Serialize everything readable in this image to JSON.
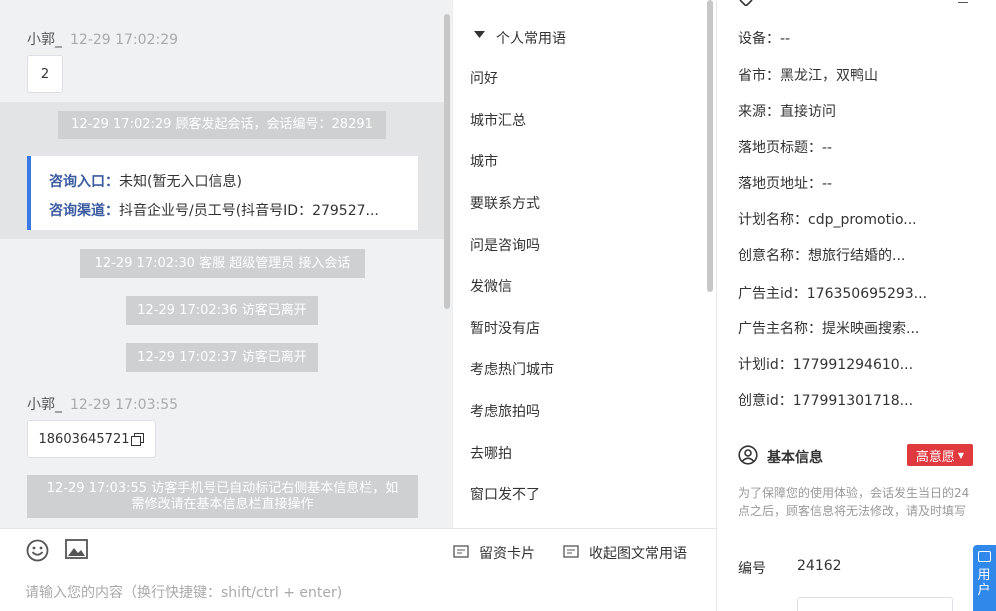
{
  "chat": {
    "msg1": {
      "sender": "小郭_",
      "time": "12-29 17:02:29",
      "text": "2"
    },
    "sys_start": "12-29 17:02:29 顾客发起会话，会话编号：28291",
    "info_card": {
      "entry_label": "咨询入口：",
      "entry_value": "未知(暂无入口信息)",
      "channel_label": "咨询渠道：",
      "channel_value": "抖音企业号/员工号(抖音号ID：279527..."
    },
    "sys_accept": "12-29 17:02:30 客服 超级管理员 接入会话",
    "sys_leave1": "12-29 17:02:36 访客已离开",
    "sys_leave2": "12-29 17:02:37 访客已离开",
    "msg2": {
      "sender": "小郭_",
      "time": "12-29 17:03:55",
      "text": "18603645721"
    },
    "sys_phone": "12-29 17:03:55 访客手机号已自动标记右侧基本信息栏，如需修改请在基本信息栏直接操作"
  },
  "composer": {
    "placeholder": "请输入您的内容（换行快捷键：shift/ctrl + enter)",
    "lead_card_label": "留资卡片",
    "collapse_label": "收起图文常用语"
  },
  "phrases": {
    "group_label": "个人常用语",
    "items": [
      "问好",
      "城市汇总",
      "城市",
      "要联系方式",
      "问是咨询吗",
      "发微信",
      "暂时没有店",
      "考虑热门城市",
      "考虑旅拍吗",
      "去哪拍",
      "窗口发不了"
    ]
  },
  "visitor_info": {
    "device": "设备：--",
    "province": "省市：黑龙江，双鸭山",
    "source": "来源：直接访问",
    "landing_title": "落地页标题：--",
    "landing_url": "落地页地址：--",
    "plan_name": "计划名称：cdp_promotio...",
    "creative_name": "创意名称：想旅行结婚的...",
    "advertiser_id": "广告主id：176350695293...",
    "advertiser_name": "广告主名称：提米映画搜索...",
    "plan_id": "计划id：177991294610...",
    "creative_id": "创意id：177991301718..."
  },
  "basic_info": {
    "title": "基本信息",
    "intent_tag": "高意愿",
    "notice": "为了保障您的使用体验，会话发生当日的24点之后，顾客信息将无法修改，请及时填写",
    "id_label": "编号",
    "id_value": "24162"
  },
  "side_tab": {
    "label": "用户"
  }
}
